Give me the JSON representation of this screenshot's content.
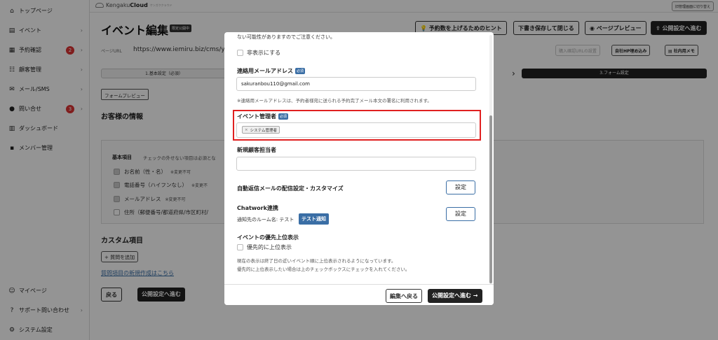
{
  "topbar": {
    "logo_text": "Kengaku",
    "logo_bold": "Cloud",
    "logo_sub": "ケンガククラウド",
    "switch_label": "旧管理画面に切り替え"
  },
  "sidebar": {
    "items": [
      {
        "label": "トップページ",
        "icon": "home-icon",
        "glyph": "⌂"
      },
      {
        "label": "イベント",
        "icon": "document-icon",
        "glyph": "▤"
      },
      {
        "label": "予約確認",
        "icon": "calendar-icon",
        "glyph": "▦",
        "badge": "2"
      },
      {
        "label": "顧客管理",
        "icon": "users-icon",
        "glyph": "☷"
      },
      {
        "label": "メール/SMS",
        "icon": "mail-icon",
        "glyph": "✉"
      },
      {
        "label": "問い合せ",
        "icon": "chat-icon",
        "glyph": "●",
        "badge": "3"
      },
      {
        "label": "ダッシュボード",
        "icon": "chart-icon",
        "glyph": "▥"
      },
      {
        "label": "メンバー管理",
        "icon": "grid-icon",
        "glyph": "▪"
      }
    ],
    "bottom_items": [
      {
        "label": "マイページ",
        "icon": "person-icon",
        "glyph": "☺"
      },
      {
        "label": "サポート問い合わせ",
        "icon": "help-icon",
        "glyph": "?"
      },
      {
        "label": "システム設定",
        "icon": "gear-icon",
        "glyph": "⚙"
      }
    ]
  },
  "page": {
    "title": "イベント編集",
    "limited_badge": "限定公開中",
    "hint_button": "予約数を上げるためのヒント",
    "save_close_button": "下書き保存して閉じる",
    "preview_button": "ページプレビュー",
    "publish_button": "公開設定へ進む",
    "url_label": "ページURL",
    "url_value": "https://www.iemiru.biz/cms/yo",
    "url_btn_disabled": "購入確認URLの設置",
    "embed_button": "自社HP埋め込み",
    "memo_button": "社内用メモ",
    "step1": "1.基本設定（必須）",
    "step3": "3.フォーム設定",
    "form_preview": "フォームプレビュー",
    "customer_info_title": "お客様の情報",
    "basic_items_label": "基本項目",
    "basic_items_note": "チェックの外せない項目は必須とな",
    "fields": [
      {
        "label": "お名前（性・名）",
        "note": "※変更不可",
        "checked": true
      },
      {
        "label": "電話番号（ハイフンなし）",
        "note": "※変更不",
        "checked": true
      },
      {
        "label": "メールアドレス",
        "note": "※変更不可",
        "checked": true
      },
      {
        "label": "住所（郵便番号/都道府県/市区町村/",
        "note": "",
        "checked": false
      }
    ],
    "custom_title": "カスタム項目",
    "add_question": "+ 質問を追加",
    "new_question_link": "質問項目の新規作成はこちら",
    "back_button": "戻る",
    "publish_bottom": "公開設定へ進む"
  },
  "modal": {
    "top_note": "ない可能性がありますのでご注意ください。",
    "hide_label": "非表示にする",
    "contact_email_label": "連絡用メールアドレス",
    "required_badge": "必須",
    "contact_email_value": "sakuranbou110@gmail.com",
    "contact_email_note": "※連絡用メールアドレスは、予約者様宛に送られる予約完了メール本文の署名に利用されます。",
    "manager_label": "イベント管理者",
    "manager_tag": "システム管理者",
    "new_owner_label": "新規顧客担当者",
    "new_owner_value": "",
    "auto_reply_label": "自動返信メールの配信設定・カスタマイズ",
    "settings_button": "設定",
    "chatwork_label": "Chatwork連携",
    "chatwork_room": "通知先のルーム名: テスト",
    "test_notify": "テスト通知",
    "chatwork_settings": "設定",
    "priority_title": "イベントの優先上位表示",
    "priority_checkbox": "優先的に上位表示",
    "priority_note1": "現在の表示は終了日の近いイベント順に上位表示されるようになっています。",
    "priority_note2": "優先的に上位表示したい場合は上のチェックボックスにチェックを入れてください。",
    "back_to_edit": "編集へ戻る",
    "go_publish": "公開設定へ進む →"
  },
  "colors": {
    "accent": "#3a6ea5",
    "highlight": "#e02020",
    "dark": "#222222",
    "badge": "#d33333"
  }
}
